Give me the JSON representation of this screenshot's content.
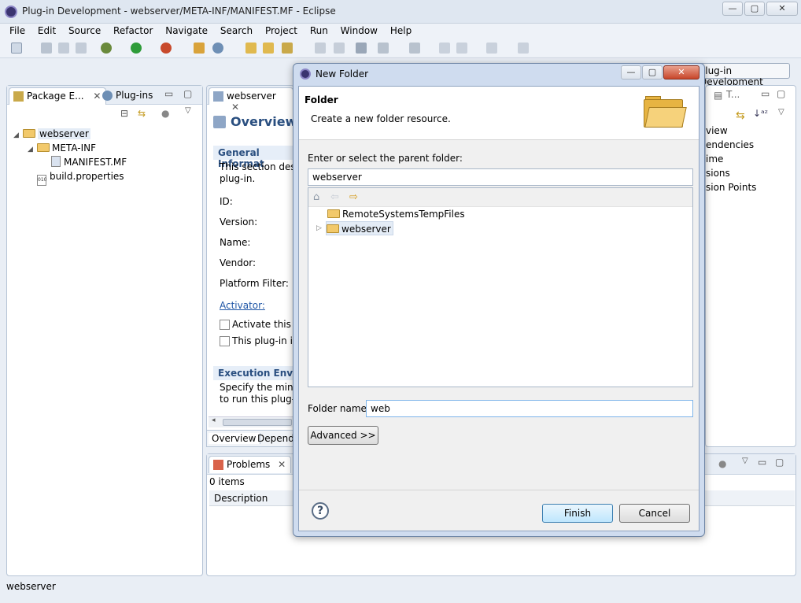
{
  "window": {
    "title": "Plug-in Development - webserver/META-INF/MANIFEST.MF - Eclipse",
    "minimize": "—",
    "maximize": "▢",
    "close": "✕"
  },
  "menu": [
    "File",
    "Edit",
    "Source",
    "Refactor",
    "Navigate",
    "Search",
    "Project",
    "Run",
    "Window",
    "Help"
  ],
  "perspective": "Plug-in Development",
  "left_panel": {
    "tabs": [
      "Package E...",
      "Plug-ins"
    ],
    "tree": [
      {
        "label": "webserver",
        "depth": 0,
        "type": "project",
        "expanded": true
      },
      {
        "label": "META-INF",
        "depth": 1,
        "type": "folder",
        "expanded": true
      },
      {
        "label": "MANIFEST.MF",
        "depth": 2,
        "type": "file"
      },
      {
        "label": "build.properties",
        "depth": 1,
        "type": "file"
      }
    ]
  },
  "editor": {
    "tab": "webserver",
    "title": "Overview",
    "section1_title": "General Informat",
    "section1_desc1": "This section descr",
    "section1_desc2": "plug-in.",
    "fields": [
      "ID:",
      "Version:",
      "Name:",
      "Vendor:",
      "Platform Filter:"
    ],
    "activator": "Activator:",
    "check1": "Activate this pl",
    "check2": "This plug-in is",
    "section2_title": "Execution Enviro",
    "section2_desc1": "Specify the minim",
    "section2_desc2": "to run this plug-i",
    "bottom_tabs": [
      "Overview",
      "Depende"
    ]
  },
  "problems": {
    "tab": "Problems",
    "items": "0 items",
    "column": "Description"
  },
  "right_panel": {
    "tab": "T...",
    "items": [
      "view",
      "endencies",
      "ime",
      "sions",
      "sion Points"
    ]
  },
  "status": "webserver",
  "dialog": {
    "title": "New Folder",
    "header": "Folder",
    "subheader": "Create a new folder resource.",
    "parent_label": "Enter or select the parent folder:",
    "parent_value": "webserver",
    "tree": [
      {
        "label": "RemoteSystemsTempFiles",
        "expandable": false
      },
      {
        "label": "webserver",
        "expandable": true,
        "selected": true
      }
    ],
    "folder_name_label": "Folder name:",
    "folder_name_value": "web",
    "advanced": "Advanced >>",
    "finish": "Finish",
    "cancel": "Cancel",
    "help": "?"
  }
}
